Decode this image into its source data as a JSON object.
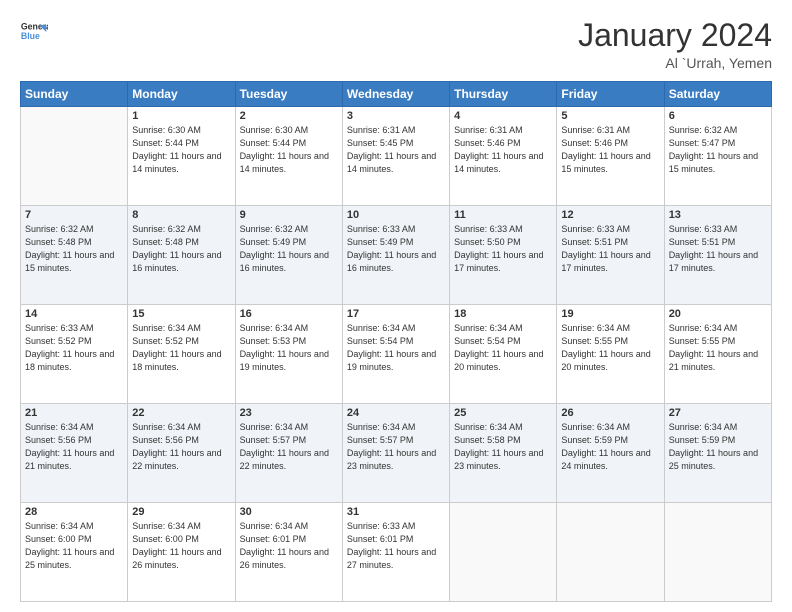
{
  "header": {
    "logo_line1": "General",
    "logo_line2": "Blue",
    "month_title": "January 2024",
    "location": "Al `Urrah, Yemen"
  },
  "days_of_week": [
    "Sunday",
    "Monday",
    "Tuesday",
    "Wednesday",
    "Thursday",
    "Friday",
    "Saturday"
  ],
  "weeks": [
    [
      {
        "day": "",
        "sunrise": "",
        "sunset": "",
        "daylight": ""
      },
      {
        "day": "1",
        "sunrise": "Sunrise: 6:30 AM",
        "sunset": "Sunset: 5:44 PM",
        "daylight": "Daylight: 11 hours and 14 minutes."
      },
      {
        "day": "2",
        "sunrise": "Sunrise: 6:30 AM",
        "sunset": "Sunset: 5:44 PM",
        "daylight": "Daylight: 11 hours and 14 minutes."
      },
      {
        "day": "3",
        "sunrise": "Sunrise: 6:31 AM",
        "sunset": "Sunset: 5:45 PM",
        "daylight": "Daylight: 11 hours and 14 minutes."
      },
      {
        "day": "4",
        "sunrise": "Sunrise: 6:31 AM",
        "sunset": "Sunset: 5:46 PM",
        "daylight": "Daylight: 11 hours and 14 minutes."
      },
      {
        "day": "5",
        "sunrise": "Sunrise: 6:31 AM",
        "sunset": "Sunset: 5:46 PM",
        "daylight": "Daylight: 11 hours and 15 minutes."
      },
      {
        "day": "6",
        "sunrise": "Sunrise: 6:32 AM",
        "sunset": "Sunset: 5:47 PM",
        "daylight": "Daylight: 11 hours and 15 minutes."
      }
    ],
    [
      {
        "day": "7",
        "sunrise": "Sunrise: 6:32 AM",
        "sunset": "Sunset: 5:48 PM",
        "daylight": "Daylight: 11 hours and 15 minutes."
      },
      {
        "day": "8",
        "sunrise": "Sunrise: 6:32 AM",
        "sunset": "Sunset: 5:48 PM",
        "daylight": "Daylight: 11 hours and 16 minutes."
      },
      {
        "day": "9",
        "sunrise": "Sunrise: 6:32 AM",
        "sunset": "Sunset: 5:49 PM",
        "daylight": "Daylight: 11 hours and 16 minutes."
      },
      {
        "day": "10",
        "sunrise": "Sunrise: 6:33 AM",
        "sunset": "Sunset: 5:49 PM",
        "daylight": "Daylight: 11 hours and 16 minutes."
      },
      {
        "day": "11",
        "sunrise": "Sunrise: 6:33 AM",
        "sunset": "Sunset: 5:50 PM",
        "daylight": "Daylight: 11 hours and 17 minutes."
      },
      {
        "day": "12",
        "sunrise": "Sunrise: 6:33 AM",
        "sunset": "Sunset: 5:51 PM",
        "daylight": "Daylight: 11 hours and 17 minutes."
      },
      {
        "day": "13",
        "sunrise": "Sunrise: 6:33 AM",
        "sunset": "Sunset: 5:51 PM",
        "daylight": "Daylight: 11 hours and 17 minutes."
      }
    ],
    [
      {
        "day": "14",
        "sunrise": "Sunrise: 6:33 AM",
        "sunset": "Sunset: 5:52 PM",
        "daylight": "Daylight: 11 hours and 18 minutes."
      },
      {
        "day": "15",
        "sunrise": "Sunrise: 6:34 AM",
        "sunset": "Sunset: 5:52 PM",
        "daylight": "Daylight: 11 hours and 18 minutes."
      },
      {
        "day": "16",
        "sunrise": "Sunrise: 6:34 AM",
        "sunset": "Sunset: 5:53 PM",
        "daylight": "Daylight: 11 hours and 19 minutes."
      },
      {
        "day": "17",
        "sunrise": "Sunrise: 6:34 AM",
        "sunset": "Sunset: 5:54 PM",
        "daylight": "Daylight: 11 hours and 19 minutes."
      },
      {
        "day": "18",
        "sunrise": "Sunrise: 6:34 AM",
        "sunset": "Sunset: 5:54 PM",
        "daylight": "Daylight: 11 hours and 20 minutes."
      },
      {
        "day": "19",
        "sunrise": "Sunrise: 6:34 AM",
        "sunset": "Sunset: 5:55 PM",
        "daylight": "Daylight: 11 hours and 20 minutes."
      },
      {
        "day": "20",
        "sunrise": "Sunrise: 6:34 AM",
        "sunset": "Sunset: 5:55 PM",
        "daylight": "Daylight: 11 hours and 21 minutes."
      }
    ],
    [
      {
        "day": "21",
        "sunrise": "Sunrise: 6:34 AM",
        "sunset": "Sunset: 5:56 PM",
        "daylight": "Daylight: 11 hours and 21 minutes."
      },
      {
        "day": "22",
        "sunrise": "Sunrise: 6:34 AM",
        "sunset": "Sunset: 5:56 PM",
        "daylight": "Daylight: 11 hours and 22 minutes."
      },
      {
        "day": "23",
        "sunrise": "Sunrise: 6:34 AM",
        "sunset": "Sunset: 5:57 PM",
        "daylight": "Daylight: 11 hours and 22 minutes."
      },
      {
        "day": "24",
        "sunrise": "Sunrise: 6:34 AM",
        "sunset": "Sunset: 5:57 PM",
        "daylight": "Daylight: 11 hours and 23 minutes."
      },
      {
        "day": "25",
        "sunrise": "Sunrise: 6:34 AM",
        "sunset": "Sunset: 5:58 PM",
        "daylight": "Daylight: 11 hours and 23 minutes."
      },
      {
        "day": "26",
        "sunrise": "Sunrise: 6:34 AM",
        "sunset": "Sunset: 5:59 PM",
        "daylight": "Daylight: 11 hours and 24 minutes."
      },
      {
        "day": "27",
        "sunrise": "Sunrise: 6:34 AM",
        "sunset": "Sunset: 5:59 PM",
        "daylight": "Daylight: 11 hours and 25 minutes."
      }
    ],
    [
      {
        "day": "28",
        "sunrise": "Sunrise: 6:34 AM",
        "sunset": "Sunset: 6:00 PM",
        "daylight": "Daylight: 11 hours and 25 minutes."
      },
      {
        "day": "29",
        "sunrise": "Sunrise: 6:34 AM",
        "sunset": "Sunset: 6:00 PM",
        "daylight": "Daylight: 11 hours and 26 minutes."
      },
      {
        "day": "30",
        "sunrise": "Sunrise: 6:34 AM",
        "sunset": "Sunset: 6:01 PM",
        "daylight": "Daylight: 11 hours and 26 minutes."
      },
      {
        "day": "31",
        "sunrise": "Sunrise: 6:33 AM",
        "sunset": "Sunset: 6:01 PM",
        "daylight": "Daylight: 11 hours and 27 minutes."
      },
      {
        "day": "",
        "sunrise": "",
        "sunset": "",
        "daylight": ""
      },
      {
        "day": "",
        "sunrise": "",
        "sunset": "",
        "daylight": ""
      },
      {
        "day": "",
        "sunrise": "",
        "sunset": "",
        "daylight": ""
      }
    ]
  ]
}
